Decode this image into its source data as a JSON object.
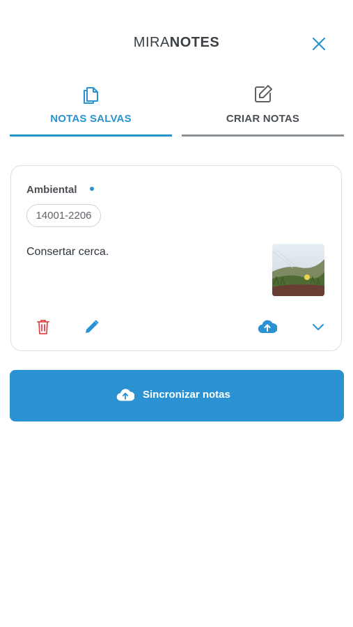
{
  "app": {
    "title_light": "MIRA",
    "title_bold": "NOTES"
  },
  "tabs": [
    {
      "label": "NOTAS SALVAS",
      "active": true
    },
    {
      "label": "CRIAR NOTAS",
      "active": false
    }
  ],
  "note": {
    "category": "Ambiental",
    "code": "14001-2206",
    "text": "Consertar cerca."
  },
  "sync_button": {
    "label": "Sincronizar notas"
  },
  "colors": {
    "accent": "#2a92d3",
    "danger": "#e0474c",
    "text": "#2b3440",
    "muted": "#8a8f94"
  },
  "icons": [
    "close-icon",
    "documents-icon",
    "edit-note-icon",
    "trash-icon",
    "pencil-icon",
    "cloud-upload-icon",
    "chevron-down-icon"
  ]
}
